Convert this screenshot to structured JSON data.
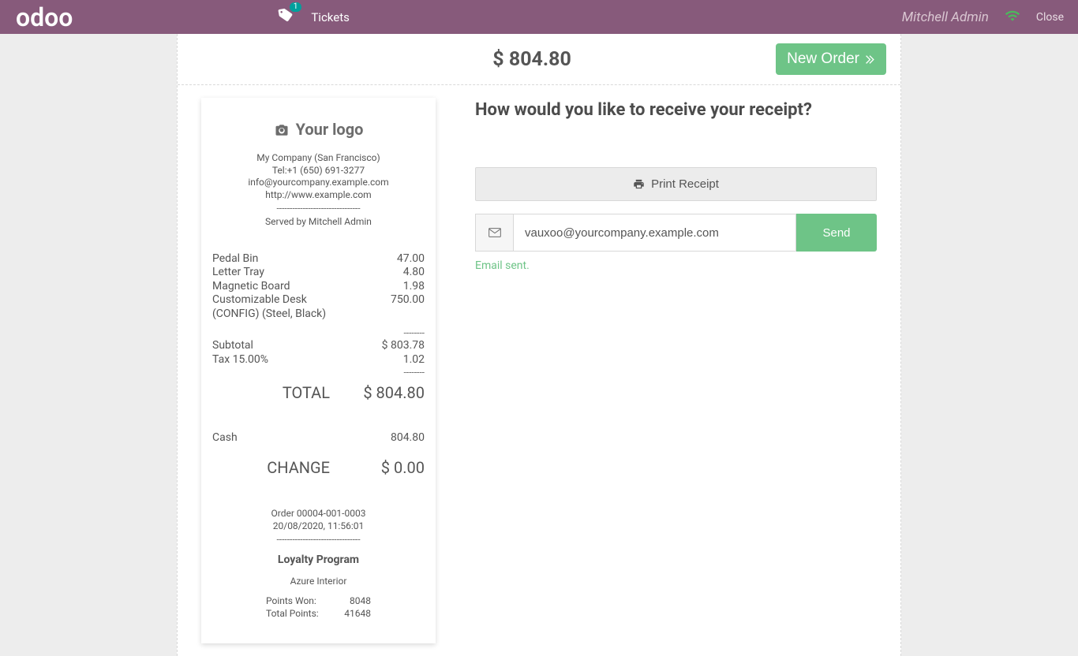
{
  "header": {
    "logo": "odoo",
    "ticket_badge": "1",
    "tickets_label": "Tickets",
    "user_name": "Mitchell Admin",
    "close_label": "Close"
  },
  "topbar": {
    "total_amount": "$ 804.80",
    "new_order_label": "New Order"
  },
  "receipt": {
    "logo_placeholder": "Your logo",
    "company_name": "My Company (San Francisco)",
    "tel": "Tel:+1 (650) 691-3277",
    "email": "info@yourcompany.example.com",
    "website": "http://www.example.com",
    "served_by": "Served by Mitchell Admin",
    "dash_sep_long": "--------------------------------",
    "dash_sep_short": "--------",
    "items": [
      {
        "name": "Pedal Bin",
        "price": "47.00"
      },
      {
        "name": "Letter Tray",
        "price": "4.80"
      },
      {
        "name": "Magnetic Board",
        "price": "1.98"
      },
      {
        "name": "Customizable Desk (CONFIG) (Steel, Black)",
        "price": "750.00"
      }
    ],
    "subtotal_label": "Subtotal",
    "subtotal_value": "$ 803.78",
    "tax_label": "Tax 15.00%",
    "tax_value": "1.02",
    "total_label": "TOTAL",
    "total_value": "$ 804.80",
    "payment_method": "Cash",
    "payment_value": "804.80",
    "change_label": "CHANGE",
    "change_value": "$ 0.00",
    "order_ref": "Order 00004-001-0003",
    "order_datetime": "20/08/2020, 11:56:01",
    "loyalty": {
      "title": "Loyalty Program",
      "partner": "Azure Interior",
      "points_won_label": "Points Won:",
      "points_won_value": "8048",
      "total_points_label": "Total Points:",
      "total_points_value": "41648"
    }
  },
  "right": {
    "question": "How would you like to receive your receipt?",
    "print_label": "Print Receipt",
    "email_value": "vauxoo@yourcompany.example.com",
    "send_label": "Send",
    "status": "Email sent."
  }
}
